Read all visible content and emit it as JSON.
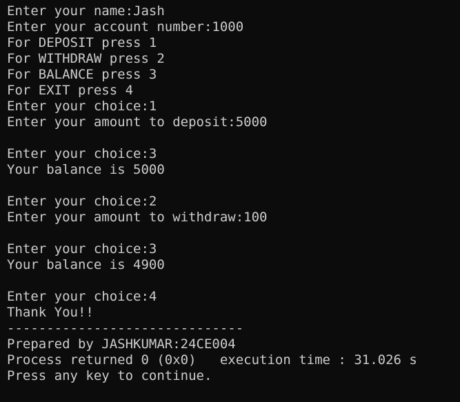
{
  "console": {
    "lines": [
      "Enter your name:Jash",
      "Enter your account number:1000",
      "For DEPOSIT press 1",
      "For WITHDRAW press 2",
      "For BALANCE press 3",
      "For EXIT press 4",
      "Enter your choice:1",
      "Enter your amount to deposit:5000",
      "",
      "Enter your choice:3",
      "Your balance is 5000",
      "",
      "Enter your choice:2",
      "Enter your amount to withdraw:100",
      "",
      "Enter your choice:3",
      "Your balance is 4900",
      "",
      "Enter your choice:4",
      "Thank You!!",
      "------------------------------",
      "Prepared by JASHKUMAR:24CE004",
      "Process returned 0 (0x0)   execution time : 31.026 s",
      "Press any key to continue."
    ]
  }
}
